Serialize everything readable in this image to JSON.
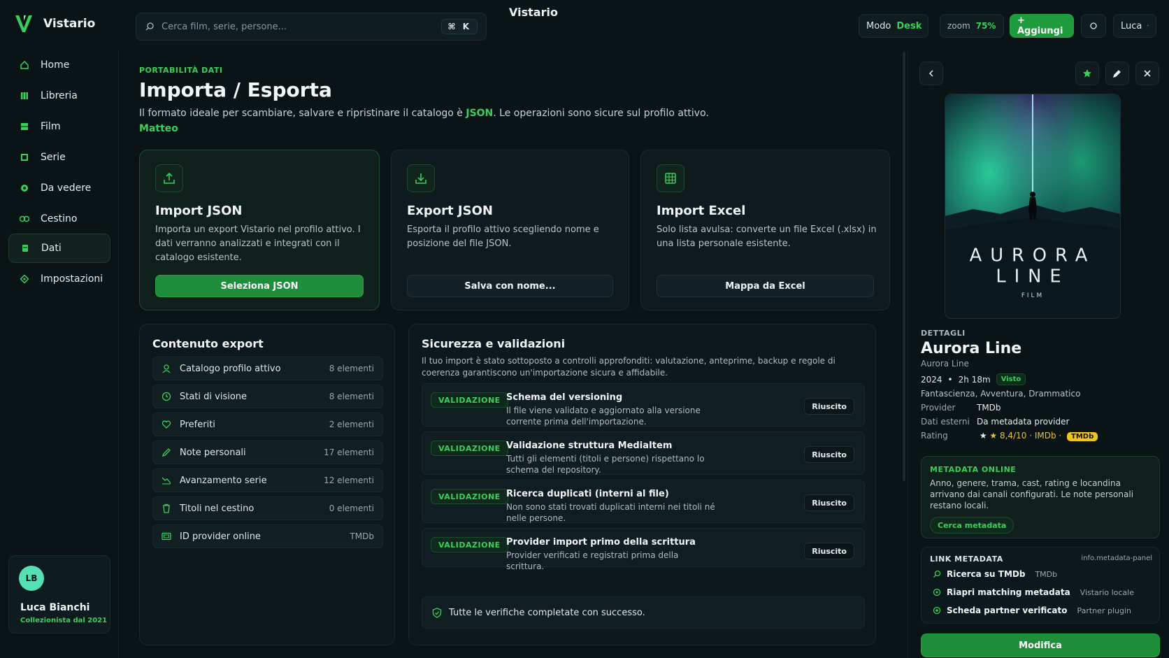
{
  "app": {
    "name": "Vistario",
    "title": "Vistario"
  },
  "topbar": {
    "search_placeholder": "Cerca film, serie, persone...",
    "search_shortcut": "⌘ K",
    "mode_label": "Modo",
    "mode_value": "Desk",
    "zoom_label": "zoom",
    "zoom_value": "75%",
    "add_label": "+ Aggiungi",
    "user_label": "Luca"
  },
  "sidebar": {
    "items": [
      {
        "label": "Home",
        "icon": "home-icon",
        "active": false
      },
      {
        "label": "Libreria",
        "icon": "library-icon",
        "active": false
      },
      {
        "label": "Film",
        "icon": "film-icon",
        "active": false
      },
      {
        "label": "Serie",
        "icon": "series-icon",
        "active": false
      },
      {
        "label": "Da vedere",
        "icon": "watchlist-icon",
        "active": false
      },
      {
        "label": "Cestino",
        "icon": "trash-icon",
        "active": false
      },
      {
        "label": "Dati",
        "icon": "data-icon",
        "active": true
      },
      {
        "label": "Impostazioni",
        "icon": "settings-icon",
        "active": false
      }
    ],
    "profile": {
      "initials": "LB",
      "name": "Luca Bianchi",
      "subtitle": "Collezionista dal 2021"
    }
  },
  "main": {
    "eyebrow": "PORTABILITÀ DATI",
    "title": "Importa / Esporta",
    "lead_prefix": "Il formato ideale per scambiare, salvare e ripristinare il catalogo è ",
    "lead_format": "JSON",
    "lead_suffix": ". Le operazioni sono sicure sul profilo attivo.",
    "profile_name": "Matteo",
    "cards": [
      {
        "title": "Import JSON",
        "description": "Importa un export Vistario nel profilo attivo. I dati verranno analizzati e integrati con il catalogo esistente.",
        "button": "Seleziona JSON",
        "icon": "upload-icon"
      },
      {
        "title": "Export JSON",
        "description": "Esporta il profilo attivo scegliendo nome e posizione del file JSON.",
        "button": "Salva con nome...",
        "icon": "download-icon"
      },
      {
        "title": "Import Excel",
        "description": "Solo lista avulsa: converte un file Excel (.xlsx) in una lista personale esistente.",
        "button": "Mappa da Excel",
        "icon": "spreadsheet-icon"
      }
    ],
    "export_content": {
      "title": "Contenuto export",
      "rows": [
        {
          "label": "Catalogo profilo attivo",
          "count": "8 elementi",
          "icon": "user-icon"
        },
        {
          "label": "Stati di visione",
          "count": "8 elementi",
          "icon": "clock-icon"
        },
        {
          "label": "Preferiti",
          "count": "2 elementi",
          "icon": "heart-icon"
        },
        {
          "label": "Note personali",
          "count": "17 elementi",
          "icon": "pencil-icon"
        },
        {
          "label": "Avanzamento serie",
          "count": "12 elementi",
          "icon": "trend-icon"
        },
        {
          "label": "Titoli nel cestino",
          "count": "0 elementi",
          "icon": "trash-icon"
        },
        {
          "label": "ID provider online",
          "count": "TMDb",
          "icon": "id-card-icon"
        }
      ]
    },
    "security": {
      "title": "Sicurezza e validazioni",
      "description": "Il tuo import è stato sottoposto a controlli approfonditi: valutazione, anteprime, backup e regole di coerenza garantiscono un'importazione sicura e affidabile.",
      "tag_label": "VALIDAZIONE",
      "status_label": "Riuscito",
      "rows": [
        {
          "title": "Schema del versioning",
          "description": "Il file viene validato e aggiornato alla versione corrente prima dell'importazione."
        },
        {
          "title": "Validazione struttura MediaItem",
          "description": "Tutti gli elementi (titoli e persone) rispettano lo schema del repository."
        },
        {
          "title": "Ricerca duplicati (interni al file)",
          "description": "Non sono stati trovati duplicati interni nei titoli né nelle persone."
        },
        {
          "title": "Provider import primo della scrittura",
          "description": "Provider verificati e registrati prima della scrittura."
        }
      ],
      "summary": "Tutte le verifiche completate con successo."
    }
  },
  "detail": {
    "poster_title_line1": "AURORA",
    "poster_title_line2": "LINE",
    "poster_subtitle": "FILM",
    "eyebrow": "DETTAGLI",
    "title": "Aurora Line",
    "original_title": "Aurora Line",
    "year": "2024",
    "duration": "2h 18m",
    "status_badge": "Visto",
    "genres": "Fantascienza, Avventura, Drammatico",
    "provider_label": "Provider",
    "provider_value": "TMDb",
    "external_label": "Dati esterni",
    "external_value": "Da metadata provider",
    "rating_label": "Rating",
    "rating_value": "★ 8,4/10 · IMDb ·",
    "rating_badge": "TMDb",
    "metadata_online": {
      "title": "METADATA ONLINE",
      "description": "Anno, genere, trama, cast, rating e locandina arrivano dai canali configurati. Le note personali restano locali.",
      "button": "Cerca metadata"
    },
    "links": {
      "title": "LINK METADATA",
      "source": "info.metadata-panel",
      "rows": [
        {
          "label": "Ricerca su TMDb",
          "tag": "TMDb",
          "icon": "search-icon"
        },
        {
          "label": "Riapri matching metadata",
          "tag": "Vistario locale",
          "icon": "refresh-icon"
        },
        {
          "label": "Scheda partner verificato",
          "tag": "Partner plugin",
          "icon": "verified-icon"
        }
      ]
    },
    "edit_button": "Modifica"
  },
  "colors": {
    "accent": "#39d05a",
    "background": "#0a1417",
    "primary_button": "#1f8e3a",
    "rating_badge": "#f0c419"
  }
}
